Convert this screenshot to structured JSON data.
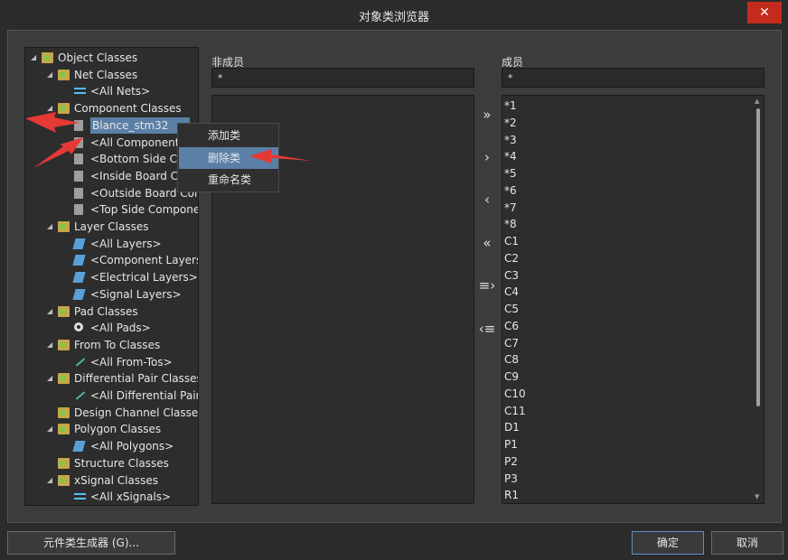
{
  "window": {
    "title": "对象类浏览器",
    "close_glyph": "✕"
  },
  "tree": {
    "items": [
      {
        "label": "Object Classes",
        "icon": "folder-icon",
        "twisty": "◢"
      },
      {
        "label": "Net Classes",
        "icon": "folder-icon",
        "twisty": "◢"
      },
      {
        "label": "<All Nets>",
        "icon": "net-icon",
        "twisty": ""
      },
      {
        "label": "Component Classes",
        "icon": "folder-icon",
        "twisty": "◢"
      },
      {
        "label": "Blance_stm32",
        "icon": "component-icon",
        "twisty": ""
      },
      {
        "label": "<All Components>",
        "icon": "component-icon",
        "twisty": ""
      },
      {
        "label": "<Bottom Side Com",
        "icon": "component-icon",
        "twisty": ""
      },
      {
        "label": "<Inside Board Com",
        "icon": "component-icon",
        "twisty": ""
      },
      {
        "label": "<Outside Board Compo",
        "icon": "component-icon",
        "twisty": ""
      },
      {
        "label": "<Top Side Components",
        "icon": "component-icon",
        "twisty": ""
      },
      {
        "label": "Layer Classes",
        "icon": "folder-icon",
        "twisty": "◢"
      },
      {
        "label": "<All Layers>",
        "icon": "layer-icon",
        "twisty": ""
      },
      {
        "label": "<Component Layers>",
        "icon": "layer-icon",
        "twisty": ""
      },
      {
        "label": "<Electrical Layers>",
        "icon": "layer-icon",
        "twisty": ""
      },
      {
        "label": "<Signal Layers>",
        "icon": "layer-icon",
        "twisty": ""
      },
      {
        "label": "Pad Classes",
        "icon": "folder-icon",
        "twisty": "◢"
      },
      {
        "label": "<All Pads>",
        "icon": "pad-icon",
        "twisty": ""
      },
      {
        "label": "From To Classes",
        "icon": "folder-icon",
        "twisty": "◢"
      },
      {
        "label": "<All From-Tos>",
        "icon": "from-to-icon",
        "twisty": ""
      },
      {
        "label": "Differential Pair Classes",
        "icon": "folder-icon",
        "twisty": "◢"
      },
      {
        "label": "<All Differential Pairs>",
        "icon": "from-to-icon",
        "twisty": ""
      },
      {
        "label": "Design Channel Classes",
        "icon": "folder-icon",
        "twisty": ""
      },
      {
        "label": "Polygon Classes",
        "icon": "folder-icon",
        "twisty": "◢"
      },
      {
        "label": "<All Polygons>",
        "icon": "layer-icon",
        "twisty": ""
      },
      {
        "label": "Structure Classes",
        "icon": "folder-icon",
        "twisty": ""
      },
      {
        "label": "xSignal Classes",
        "icon": "folder-icon",
        "twisty": "◢"
      },
      {
        "label": "<All xSignals>",
        "icon": "net-icon",
        "twisty": ""
      }
    ],
    "selected_index": 4
  },
  "non_members": {
    "label": "非成员",
    "filter_value": "*"
  },
  "members": {
    "label": "成员",
    "filter_value": "*",
    "items": [
      "*1",
      "*2",
      "*3",
      "*4",
      "*5",
      "*6",
      "*7",
      "*8",
      "C1",
      "C2",
      "C3",
      "C4",
      "C5",
      "C6",
      "C7",
      "C8",
      "C9",
      "C10",
      "C11",
      "D1",
      "P1",
      "P2",
      "P3",
      "R1"
    ]
  },
  "transfer_buttons": [
    {
      "glyph": "»",
      "name": "add-all-button"
    },
    {
      "glyph": "›",
      "name": "add-selected-button"
    },
    {
      "glyph": "‹",
      "name": "remove-selected-button"
    },
    {
      "glyph": "«",
      "name": "remove-all-button"
    },
    {
      "glyph": "≡›",
      "name": "add-matching-button"
    },
    {
      "glyph": "‹≡",
      "name": "remove-matching-button"
    }
  ],
  "context_menu": {
    "items": [
      "添加类",
      "删除类",
      "重命名类"
    ],
    "active_index": 1
  },
  "footer": {
    "generator_label": "元件类生成器 (G)...",
    "ok_label": "确定",
    "cancel_label": "取消"
  },
  "colors": {
    "selection": "#5b7fa6",
    "annotation_arrow": "#e53935",
    "close": "#c42b1c"
  }
}
